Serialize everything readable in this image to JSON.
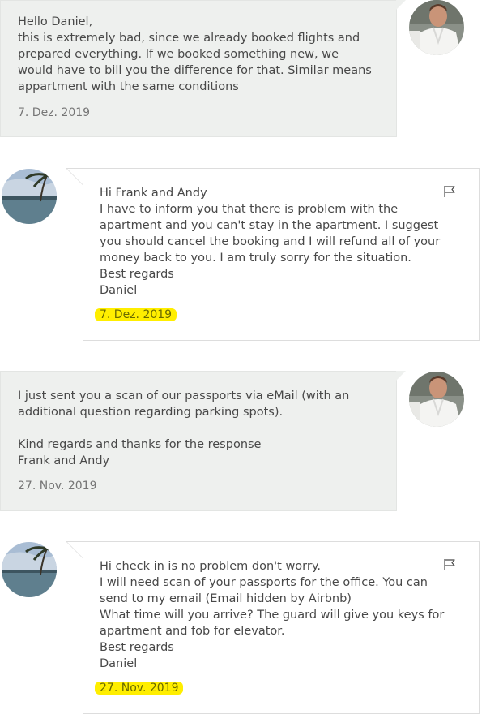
{
  "messages": [
    {
      "direction": "outgoing",
      "text": "Hello Daniel,\nthis is extremely bad, since we already booked flights and prepared everything. If we booked something new, we would have to bill you the difference for that. Similar means appartment with the same conditions",
      "date": "7. Dez. 2019",
      "highlighted": false
    },
    {
      "direction": "incoming",
      "text": "Hi Frank and Andy\nI have to inform you that there is problem with the apartment and you can't stay in the apartment. I suggest you should cancel the booking and I will refund all of your money back to you. I am truly sorry for the situation.\nBest regards\nDaniel",
      "date": "7. Dez. 2019",
      "highlighted": true
    },
    {
      "direction": "outgoing",
      "text": "I just sent you a scan of our passports via eMail (with an additional question regarding parking spots).\n\nKind regards and thanks for the response\nFrank and Andy",
      "date": "27. Nov. 2019",
      "highlighted": false
    },
    {
      "direction": "incoming",
      "text": "Hi check in is no problem don't worry.\nI will need scan of your passports for the office. You can send to my email (Email hidden by Airbnb)\nWhat time will you arrive? The guard will give you keys for apartment and fob for elevator.\nBest regards\nDaniel",
      "date": "27. Nov. 2019",
      "highlighted": true
    }
  ],
  "icons": {
    "guest_avatar": "man-in-white-gi-avatar",
    "host_avatar": "palm-tree-beach-avatar",
    "report": "flag-icon"
  },
  "colors": {
    "outgoing_bg": "#eef0ee",
    "highlight": "#ffee00",
    "date_text": "#767676"
  }
}
